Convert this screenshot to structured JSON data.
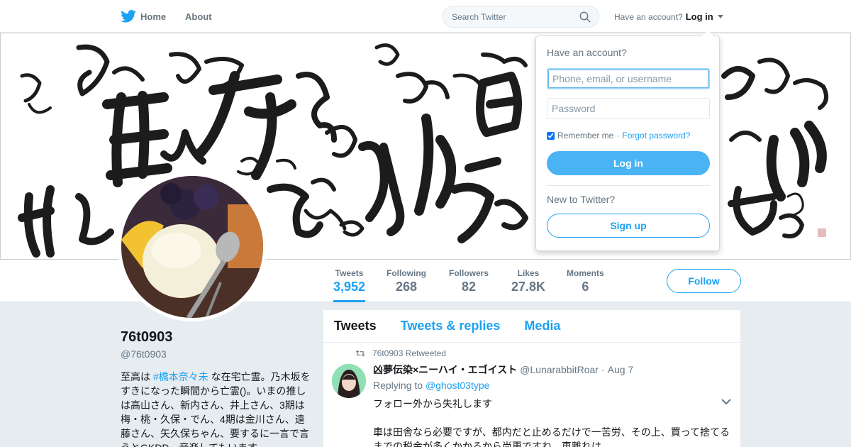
{
  "colors": {
    "brand": "#1da1f2",
    "login_button": "#4ab3f4"
  },
  "nav": {
    "logo_icon": "twitter-bird-icon",
    "home_label": "Home",
    "about_label": "About",
    "search_placeholder": "Search Twitter",
    "account_prompt": "Have an account?",
    "login_label": "Log in"
  },
  "banner": {
    "image": "calligraphy-banner"
  },
  "profile_nav": {
    "stats": [
      {
        "label": "Tweets",
        "value": "3,952"
      },
      {
        "label": "Following",
        "value": "268"
      },
      {
        "label": "Followers",
        "value": "82"
      },
      {
        "label": "Likes",
        "value": "27.8K"
      },
      {
        "label": "Moments",
        "value": "6"
      }
    ],
    "follow_label": "Follow"
  },
  "profile": {
    "name": "76t0903",
    "handle": "@76t0903",
    "bio_before": "至高は ",
    "bio_hashtag": "#橋本奈々未",
    "bio_after": " な在宅亡霊。乃木坂をすきになった瞬間から亡霊()。いまの推しは高山さん、新内さん、井上さん、3期は梅・桃・久保・でん、4期は金川さん、遠藤さん、矢久保ちゃん、要するに一言で言うとGKDD。音楽してもいます。"
  },
  "timeline": {
    "tabs": [
      "Tweets",
      "Tweets & replies",
      "Media"
    ],
    "tweet": {
      "retweet_context": "76t0903 Retweeted",
      "author_name": "凶夢伝染×ニーハイ・エゴイスト",
      "author_handle": "@LunarabbitRoar",
      "separator": "·",
      "date": "Aug 7",
      "reply_prefix": "Replying to",
      "reply_mention": "@ghost03type",
      "text_line1": "フォロー外から失礼します",
      "text_line2": "車は田舎なら必要ですが、都内だと止めるだけで一苦労、その上、買って捨てるまでの税金が多くかかるから尚更ですね。車離れは"
    }
  },
  "login_dropdown": {
    "title": "Have an account?",
    "username_placeholder": "Phone, email, or username",
    "password_placeholder": "Password",
    "remember_label": "Remember me",
    "separator": "·",
    "forgot_label": "Forgot password?",
    "login_button": "Log in",
    "new_prompt": "New to Twitter?",
    "signup_button": "Sign up"
  }
}
